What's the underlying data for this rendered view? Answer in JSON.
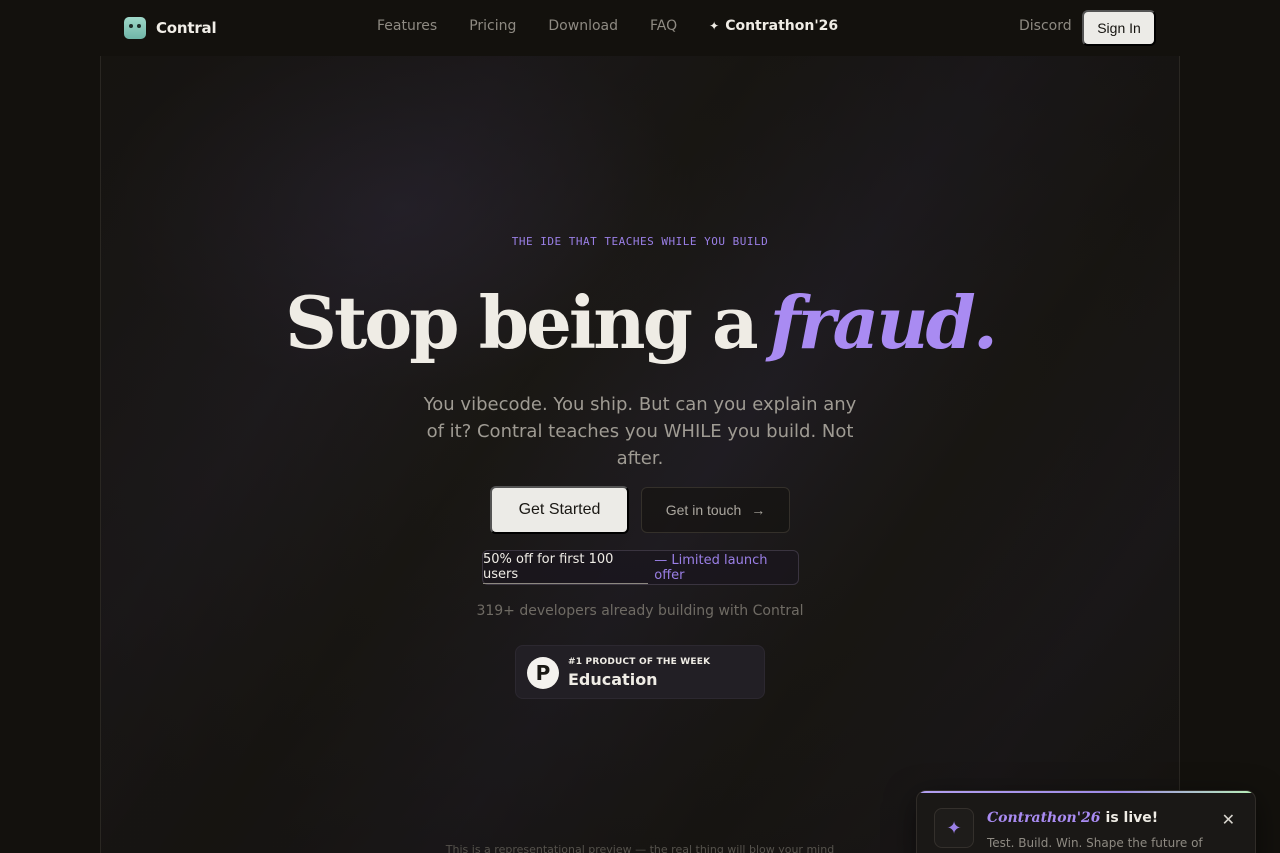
{
  "nav": {
    "brand": "Contral",
    "links": [
      "Features",
      "Pricing",
      "Download",
      "FAQ"
    ],
    "special_link": "Contrathon'26",
    "discord": "Discord",
    "signin": "Sign In"
  },
  "hero": {
    "eyebrow": "THE IDE THAT TEACHES WHILE YOU BUILD",
    "headline_main": "Stop being a",
    "headline_accent": "fraud.",
    "subhead": "You vibecode. You ship. But can you explain any of it? Contral teaches you WHILE you build. Not after.",
    "primary_cta": "Get Started",
    "secondary_cta": "Get in touch",
    "offer_main": "50% off for first 100 users",
    "offer_sub": "— Limited launch offer",
    "social_proof": "319+ developers already building with Contral",
    "badge_small": "#1 PRODUCT OF THE WEEK",
    "badge_big": "Education",
    "badge_logo": "P",
    "preview_note": "This is a representational preview — the real thing will blow your mind"
  },
  "toast": {
    "title_accent": "Contrathon'26",
    "title_rest": "is live!",
    "body": "Test. Build. Win. Shape the future of",
    "close": "✕"
  },
  "icons": {
    "sparkle": "sparkle-icon",
    "arrow": "arrow-right-icon",
    "close": "close-icon"
  },
  "colors": {
    "accent": "#a98bf2",
    "background": "#13110d",
    "button": "#ecebe7"
  }
}
